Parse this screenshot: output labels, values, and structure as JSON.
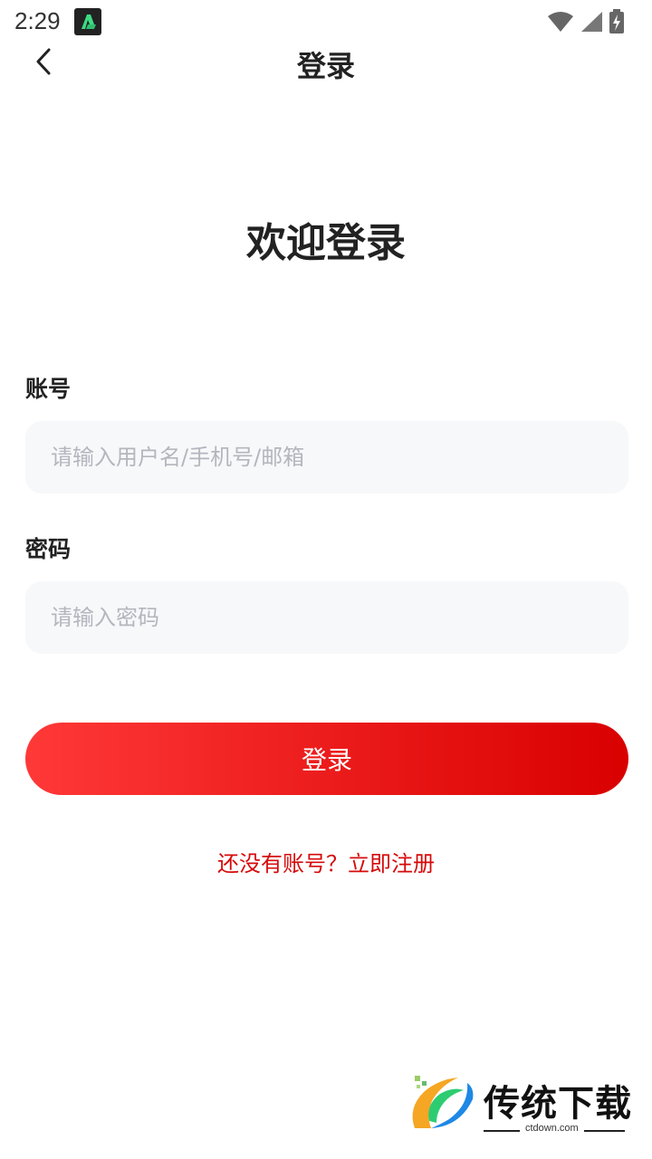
{
  "status_bar": {
    "time": "2:29",
    "icons": [
      "app-icon",
      "wifi-icon",
      "signal-icon",
      "battery-charging-icon"
    ]
  },
  "nav": {
    "title": "登录",
    "back_icon": "chevron-left-icon"
  },
  "welcome": {
    "title": "欢迎登录"
  },
  "form": {
    "account_label": "账号",
    "account_placeholder": "请输入用户名/手机号/邮箱",
    "password_label": "密码",
    "password_placeholder": "请输入密码",
    "submit_label": "登录",
    "register_link": "还没有账号？立即注册"
  },
  "watermark": {
    "brand": "传统下载",
    "domain": "ctdown.com"
  },
  "colors": {
    "accent_start": "#ff3838",
    "accent_end": "#d90000",
    "link": "#d50b0b",
    "input_bg": "#f7f8fa"
  }
}
